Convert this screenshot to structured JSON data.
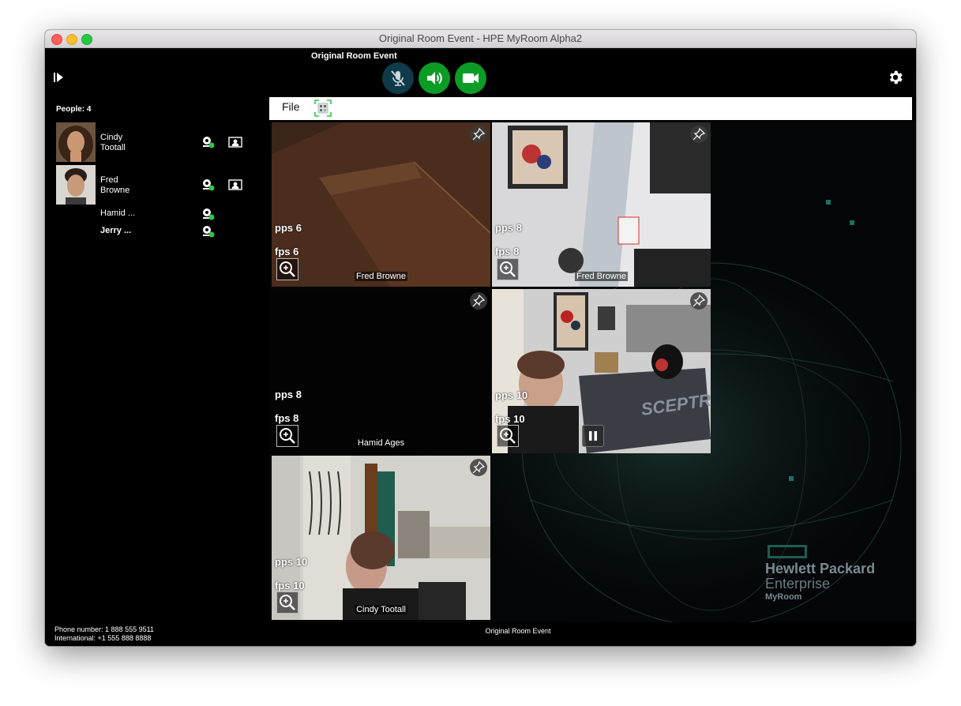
{
  "window": {
    "title": "Original Room Event - HPE MyRoom Alpha2"
  },
  "toolbar": {
    "event_title": "Original Room Event",
    "controls": [
      {
        "name": "microphone-muted",
        "color": "#0e3a4a"
      },
      {
        "name": "speaker",
        "color": "#0a9c24"
      },
      {
        "name": "camera",
        "color": "#0a9c24"
      }
    ]
  },
  "sidebar": {
    "people_label": "People: 4",
    "people": [
      {
        "name_line1": "Cindy",
        "name_line2": "Tootall",
        "has_avatar": true,
        "camera_icon": "webcam-icon",
        "share_icon": "contact-card-icon"
      },
      {
        "name_line1": "Fred",
        "name_line2": "Browne",
        "has_avatar": true,
        "camera_icon": "webcam-icon",
        "share_icon": "contact-card-icon"
      },
      {
        "name": "Hamid ...",
        "has_avatar": false,
        "camera_icon": "webcam-icon"
      },
      {
        "name": "Jerry ...",
        "has_avatar": false,
        "camera_icon": "webcam-icon"
      }
    ],
    "phone_number": "Phone number: 1 888 555 9511",
    "international": "International:  +1 555 888 8888"
  },
  "menubar": {
    "file_label": "File"
  },
  "tiles": [
    {
      "pps": "pps 6",
      "fps": "fps 6",
      "name": "Fred Browne"
    },
    {
      "pps": "pps 8",
      "fps": "fps 8",
      "name": "Fred Browne"
    },
    {
      "pps": "pps 8",
      "fps": "fps 8",
      "name": "Hamid Ages"
    },
    {
      "pps": "pps 10",
      "fps": "fps 10",
      "name": "",
      "active": true
    },
    {
      "pps": "pps 10",
      "fps": "fps 10",
      "name": "Cindy Tootall"
    }
  ],
  "branding": {
    "line1": "Hewlett Packard",
    "line2": "Enterprise",
    "line3": "MyRoom"
  },
  "footer": {
    "event_title": "Original Room Event"
  },
  "colors": {
    "accent_green": "#0a9c24",
    "active_border": "#0fa38a",
    "brand_teal": "#1f5c52"
  }
}
